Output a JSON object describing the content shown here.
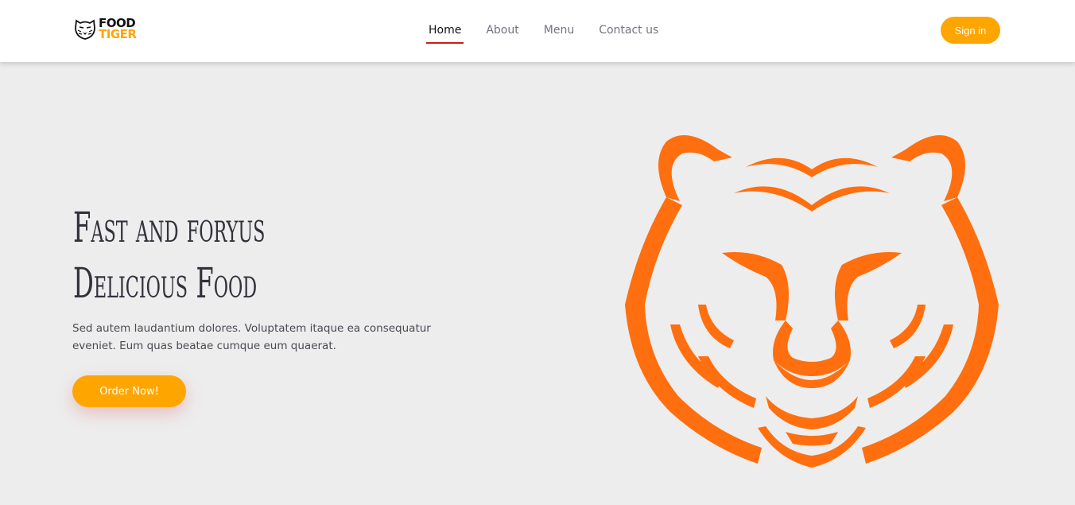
{
  "brand": {
    "line1": "FOOD",
    "line2": "TIGER",
    "mark_icon": "tiger-head-icon",
    "line2_color": "#ffa500"
  },
  "nav": {
    "items": [
      {
        "label": "Home",
        "active": true
      },
      {
        "label": "About",
        "active": false
      },
      {
        "label": "Menu",
        "active": false
      },
      {
        "label": "Contact us",
        "active": false
      }
    ],
    "active_underline_color": "#c61e1e"
  },
  "header": {
    "signin_label": "Sign in"
  },
  "hero": {
    "title_line1": "Fast and foryus",
    "title_line2": "Delicious Food",
    "description": "Sed autem laudantium dolores. Voluptatem itaque ea consequatur eveniet. Eum quas beatae cumque eum quaerat.",
    "cta_label": "Order Now!",
    "illustration_icon": "tiger-face-icon"
  },
  "colors": {
    "accent": "#ffa500",
    "tiger": "#ff6f0f",
    "background": "#ededed",
    "header_bg": "#ffffff"
  }
}
